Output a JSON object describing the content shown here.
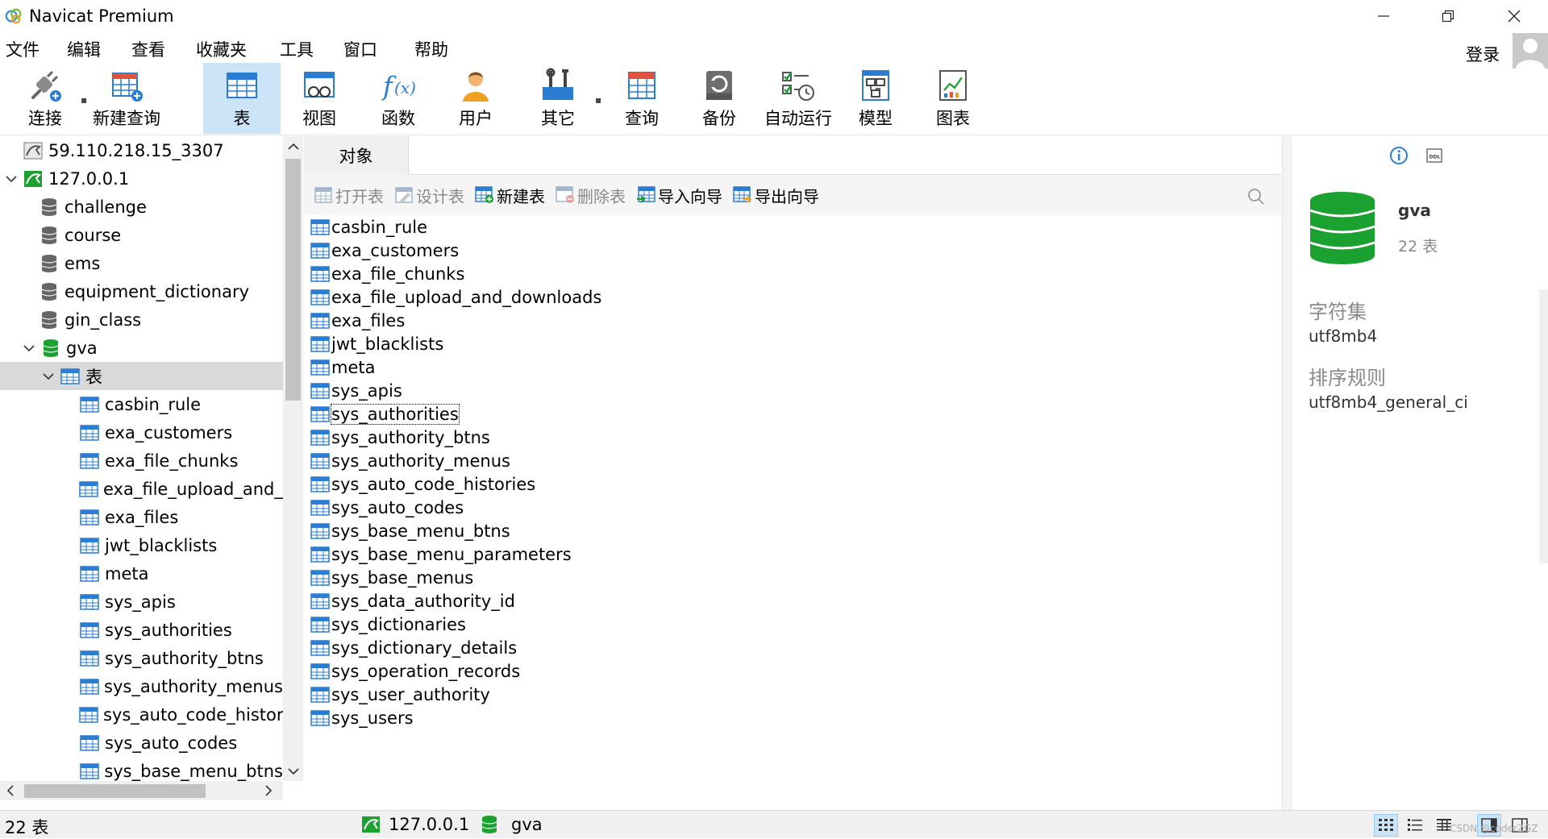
{
  "window": {
    "title": "Navicat Premium"
  },
  "menu": {
    "items": [
      "文件",
      "编辑",
      "查看",
      "收藏夹",
      "工具",
      "窗口",
      "帮助"
    ]
  },
  "account": {
    "login": "登录"
  },
  "toolbar": {
    "connect": "连接",
    "new_query": "新建查询",
    "table": "表",
    "view": "视图",
    "function": "函数",
    "user": "用户",
    "other": "其它",
    "query": "查询",
    "backup": "备份",
    "auto_run": "自动运行",
    "model": "模型",
    "chart": "图表"
  },
  "tree": {
    "connections": {
      "remote": "59.110.218.15_3307",
      "local": "127.0.0.1"
    },
    "databases": [
      "challenge",
      "course",
      "ems",
      "equipment_dictionary",
      "gin_class"
    ],
    "active_db": "gva",
    "tables_group": "表",
    "tables": [
      "casbin_rule",
      "exa_customers",
      "exa_file_chunks",
      "exa_file_upload_and_d",
      "exa_files",
      "jwt_blacklists",
      "meta",
      "sys_apis",
      "sys_authorities",
      "sys_authority_btns",
      "sys_authority_menus",
      "sys_auto_code_histori",
      "sys_auto_codes",
      "sys_base_menu_btns"
    ]
  },
  "objects": {
    "tab": "对象",
    "toolbar": {
      "open": "打开表",
      "design": "设计表",
      "new": "新建表",
      "delete": "删除表",
      "import": "导入向导",
      "export": "导出向导"
    },
    "tables": [
      "casbin_rule",
      "exa_customers",
      "exa_file_chunks",
      "exa_file_upload_and_downloads",
      "exa_files",
      "jwt_blacklists",
      "meta",
      "sys_apis",
      "sys_authorities",
      "sys_authority_btns",
      "sys_authority_menus",
      "sys_auto_code_histories",
      "sys_auto_codes",
      "sys_base_menu_btns",
      "sys_base_menu_parameters",
      "sys_base_menus",
      "sys_data_authority_id",
      "sys_dictionaries",
      "sys_dictionary_details",
      "sys_operation_records",
      "sys_user_authority",
      "sys_users"
    ],
    "focused_index": 8
  },
  "info": {
    "db_name": "gva",
    "table_count": "22 表",
    "charset_label": "字符集",
    "charset_value": "utf8mb4",
    "collation_label": "排序规则",
    "collation_value": "utf8mb4_general_ci"
  },
  "status": {
    "count": "22 表",
    "connection": "127.0.0.1",
    "database": "gva",
    "watermark": "CSDN @coderZGZ"
  },
  "colors": {
    "selection": "#cce4f7",
    "tree_selected": "#d9d9d9",
    "db_green": "#1aa130",
    "table_blue": "#2b7cd3"
  }
}
